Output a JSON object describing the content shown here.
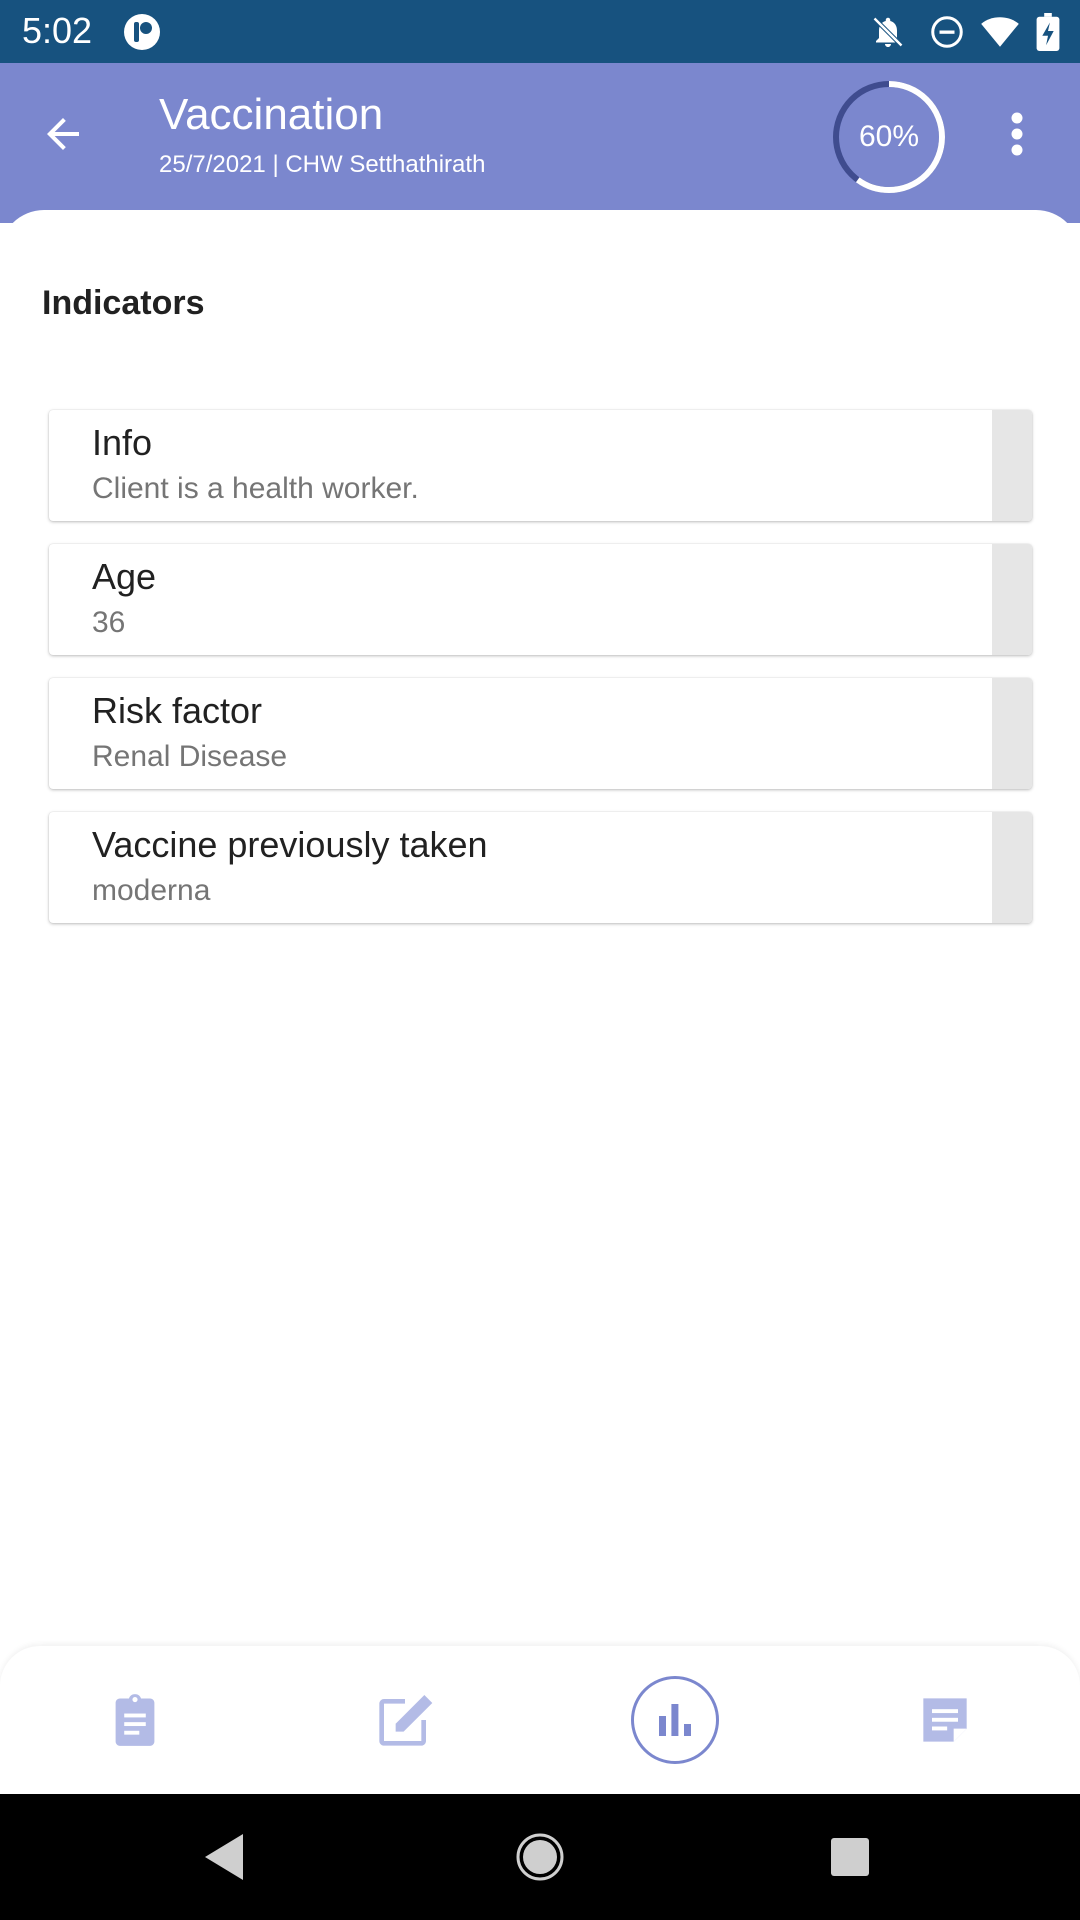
{
  "status_bar": {
    "time": "5:02",
    "icons": [
      "app-notification-icon",
      "notifications-off-icon",
      "do-not-disturb-icon",
      "wifi-icon",
      "battery-charging-icon"
    ]
  },
  "header": {
    "title": "Vaccination",
    "subtitle": "25/7/2021 | CHW Setthathirath",
    "progress_label": "60%",
    "progress_fraction": 0.6,
    "colors": {
      "header_bg": "#7b87ce",
      "status_bg": "#17527f",
      "ring_fill": "#ffffff",
      "ring_track": "#3f4c8f"
    }
  },
  "section": {
    "title": "Indicators"
  },
  "indicators": [
    {
      "label": "Info",
      "value": "Client is a health worker."
    },
    {
      "label": "Age",
      "value": "36"
    },
    {
      "label": "Risk factor",
      "value": "Renal Disease"
    },
    {
      "label": "Vaccine previously taken",
      "value": "moderna"
    }
  ],
  "bottom_nav": {
    "items": [
      "clipboard-icon",
      "edit-icon",
      "bar-chart-icon",
      "notes-icon"
    ],
    "active": "bar-chart-icon",
    "accent": "#7b87ce"
  },
  "system_nav": [
    "back-triangle-icon",
    "home-circle-icon",
    "recents-square-icon"
  ]
}
